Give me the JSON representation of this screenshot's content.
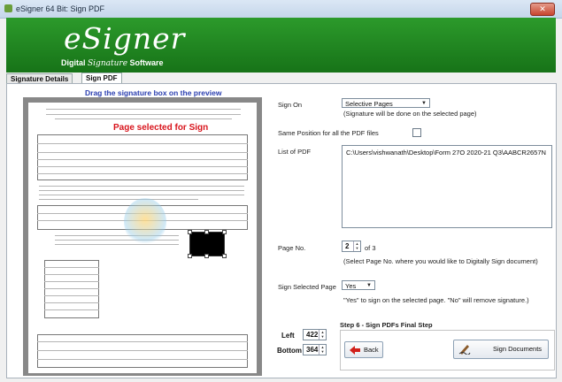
{
  "window": {
    "title": "eSigner 64 Bit: Sign PDF"
  },
  "banner": {
    "logo": "eSigner",
    "tagline_pre": "Digital ",
    "tagline_script": "Signature",
    "tagline_post": " Software"
  },
  "tabs": [
    {
      "label": "Signature Details"
    },
    {
      "label": "Sign PDF"
    }
  ],
  "preview": {
    "heading": "Drag the signature box on the preview",
    "page_selected": "Page selected for Sign"
  },
  "form": {
    "sign_on_label": "Sign On",
    "sign_on_value": "Selective Pages",
    "sign_on_hint": "(Signature will be done on the selected page)",
    "same_position_label": "Same Position for all the PDF files",
    "list_label": "List of PDF",
    "list_value": "C:\\Users\\vishwanath\\Desktop\\Form 27O 2020-21 Q3\\AABCR2657N",
    "page_no_label": "Page No.",
    "page_no_value": "2",
    "page_of": "of 3",
    "page_hint": "(Select Page No. where you would like to Digitally Sign document)",
    "sign_selected_label": "Sign Selected Page",
    "sign_selected_value": "Yes",
    "sign_selected_hint": "\"Yes\" to sign on the selected page. \"No\" will remove signature.)",
    "left_label": "Left",
    "left_value": "422",
    "bottom_label": "Bottom",
    "bottom_value": "364",
    "step_title": "Step 6 - Sign PDFs Final Step",
    "back_label": "Back",
    "sign_label": "Sign Documents"
  },
  "colors": {
    "banner": "#1f8a20",
    "heading_blue": "#2a3eb0",
    "page_selected_red": "#d8141c"
  },
  "icons": {
    "app": "esigner-app-icon",
    "close": "close-icon",
    "back": "red-arrow-back-icon",
    "sign": "pen-sign-icon"
  }
}
